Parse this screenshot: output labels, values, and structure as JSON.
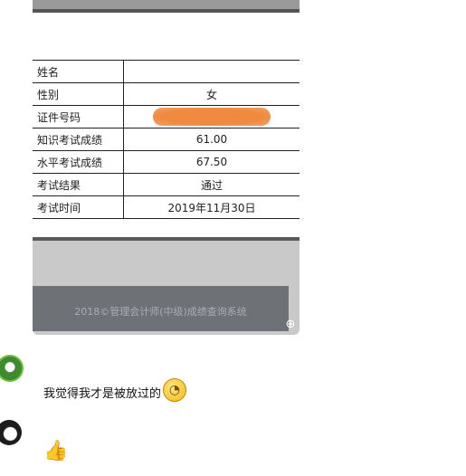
{
  "table": {
    "rows": [
      {
        "label": "姓名",
        "value": ""
      },
      {
        "label": "性别",
        "value": "女"
      },
      {
        "label": "证件号码",
        "value": ""
      },
      {
        "label": "知识考试成绩",
        "value": "61.00"
      },
      {
        "label": "水平考试成绩",
        "value": "67.50"
      },
      {
        "label": "考试结果",
        "value": "通过"
      },
      {
        "label": "考试时间",
        "value": "2019年11月30日"
      }
    ]
  },
  "footer": {
    "text": "2018©管理会计师(中级)成绩查询系统"
  },
  "chat": {
    "message1": "我觉得我才是被放过的",
    "emoji1": "surprised-emoji",
    "emoji2": "thumbs-up-emoji"
  },
  "colors": {
    "footer_bg": "#6e7176",
    "redaction": "#f08a3e"
  }
}
